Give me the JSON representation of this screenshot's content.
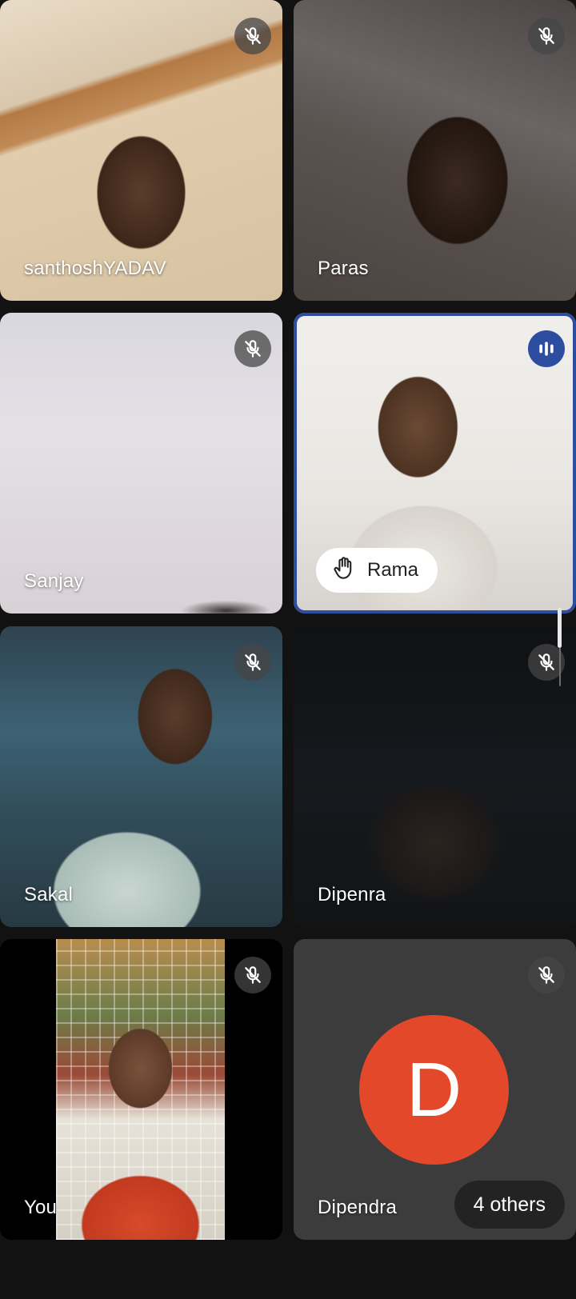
{
  "participants": [
    {
      "name": "santhoshYADAV",
      "mic": "mic-off-icon",
      "state": "muted"
    },
    {
      "name": "Paras",
      "mic": "mic-off-icon",
      "state": "muted"
    },
    {
      "name": "Sanjay",
      "mic": "mic-off-icon",
      "state": "muted"
    },
    {
      "name": "Rama",
      "mic": "speaking-icon",
      "state": "speaking",
      "hand_raised": true,
      "hand_icon": "raised-hand-icon"
    },
    {
      "name": "Sakal",
      "mic": "mic-off-icon",
      "state": "muted"
    },
    {
      "name": "Dipenra",
      "mic": "mic-off-icon",
      "state": "muted"
    },
    {
      "name": "You",
      "mic": "mic-off-icon",
      "state": "muted"
    },
    {
      "name": "Dipendra",
      "mic": "mic-off-icon",
      "state": "muted",
      "avatar_letter": "D",
      "avatar_color": "#e3482b"
    }
  ],
  "others_label": "4 others",
  "colors": {
    "background": "#121212",
    "active_speaker": "#2c4da0",
    "avatar": "#e3482b"
  }
}
